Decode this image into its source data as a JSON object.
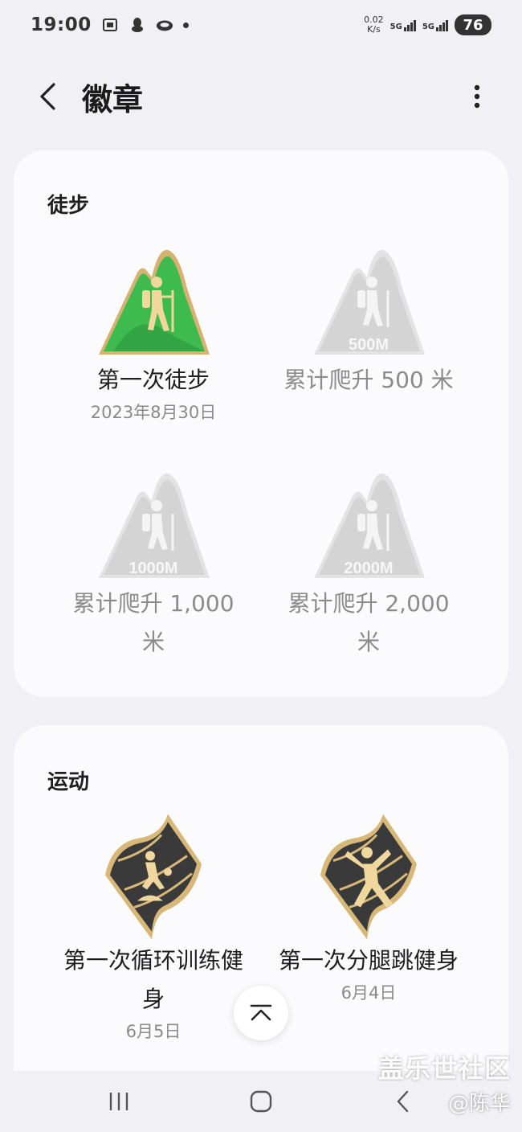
{
  "status_bar": {
    "time": "19:00",
    "net_speed_value": "0.02",
    "net_speed_unit": "K/s",
    "sim1": "5G",
    "sim2": "5G",
    "battery": "76"
  },
  "header": {
    "title": "徽章"
  },
  "sections": [
    {
      "title": "徒步",
      "badges": [
        {
          "name": "第一次徒步",
          "date": "2023年8月30日",
          "earned": true,
          "art_label": ""
        },
        {
          "name": "累计爬升 500 米",
          "date": "",
          "earned": false,
          "art_label": "500M"
        },
        {
          "name_line1": "累计爬升 1,000",
          "name_line2": "米",
          "earned": false,
          "art_label": "1000M"
        },
        {
          "name_line1": "累计爬升 2,000",
          "name_line2": "米",
          "earned": false,
          "art_label": "2000M"
        }
      ]
    },
    {
      "title": "运动",
      "badges": [
        {
          "name_line1": "第一次循环训练健",
          "name_line2": "身",
          "date": "6月5日",
          "earned": true
        },
        {
          "name": "第一次分腿跳健身",
          "date": "6月4日",
          "earned": true
        }
      ]
    }
  ],
  "watermark": {
    "line1": "盖乐世社区",
    "line2": "@陈华"
  },
  "colors": {
    "background": "#f1f1f5",
    "card": "#fbfbfd",
    "badge_green": "#3dbb4f",
    "badge_gold": "#d8b878",
    "badge_dark": "#3a3a3a"
  }
}
